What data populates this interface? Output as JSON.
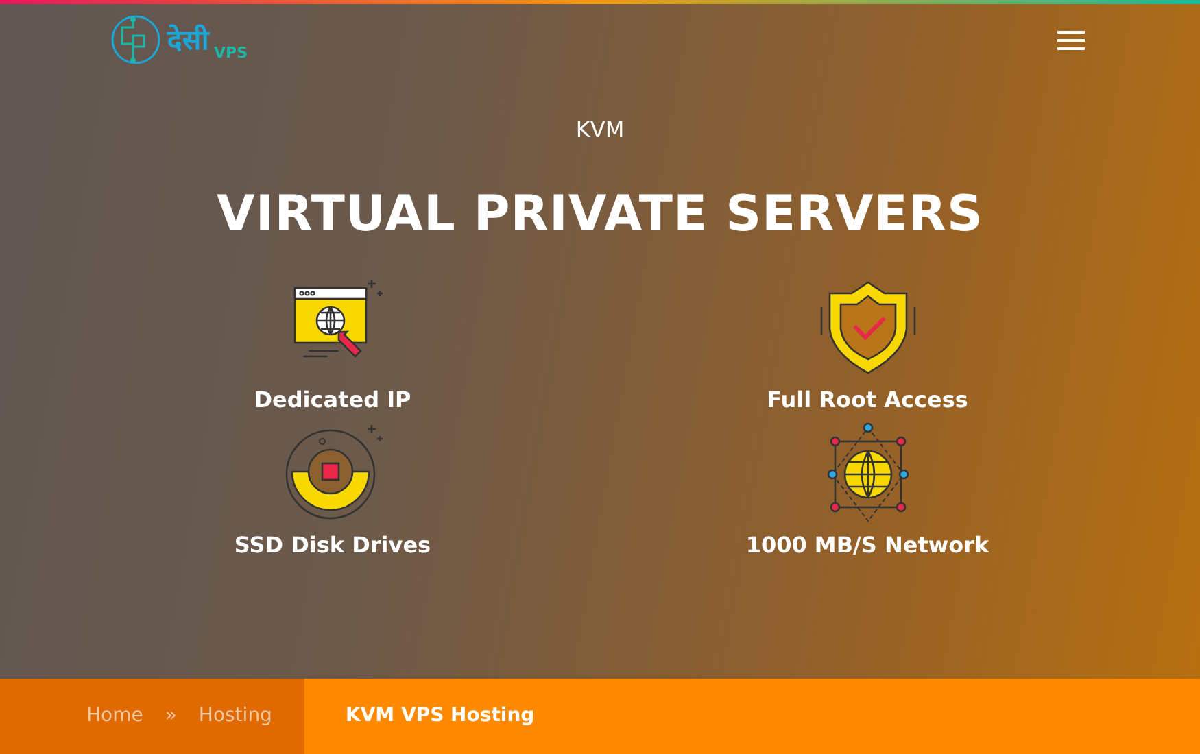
{
  "logo": {
    "script_text": "देसी",
    "suffix": "VPS"
  },
  "hero": {
    "eyebrow": "KVM",
    "title": "VIRTUAL PRIVATE SERVERS"
  },
  "features": [
    {
      "kind": "browser",
      "label": "Dedicated IP"
    },
    {
      "kind": "shield",
      "label": "Full Root Access"
    },
    {
      "kind": "disk",
      "label": "SSD Disk Drives"
    },
    {
      "kind": "network",
      "label": "1000 MB/S Network"
    }
  ],
  "breadcrumb": {
    "items": [
      {
        "label": "Home"
      },
      {
        "label": "Hosting"
      }
    ],
    "separator": "»",
    "current": "KVM VPS Hosting"
  }
}
